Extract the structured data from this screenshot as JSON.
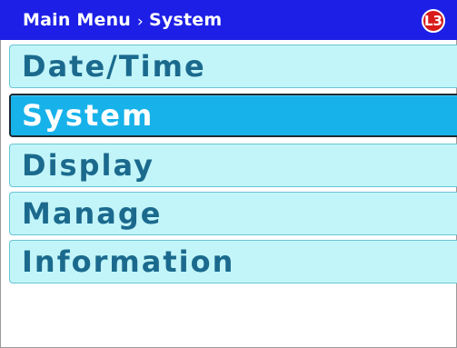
{
  "header": {
    "breadcrumb": [
      "Main Menu",
      "System"
    ],
    "breadcrumb_separator": "›",
    "logo_text": "L3"
  },
  "menu": {
    "items": [
      {
        "label": "Date/Time",
        "selected": false
      },
      {
        "label": "System",
        "selected": true
      },
      {
        "label": "Display",
        "selected": false
      },
      {
        "label": "Manage",
        "selected": false
      },
      {
        "label": "Information",
        "selected": false
      }
    ]
  },
  "colors": {
    "title_bar": "#1d1fe6",
    "item_background": "#c2f5f9",
    "item_text": "#1b6a8e",
    "selected_background": "#17b2ea",
    "selected_text": "#ffffff",
    "logo": "#d81b1b"
  }
}
